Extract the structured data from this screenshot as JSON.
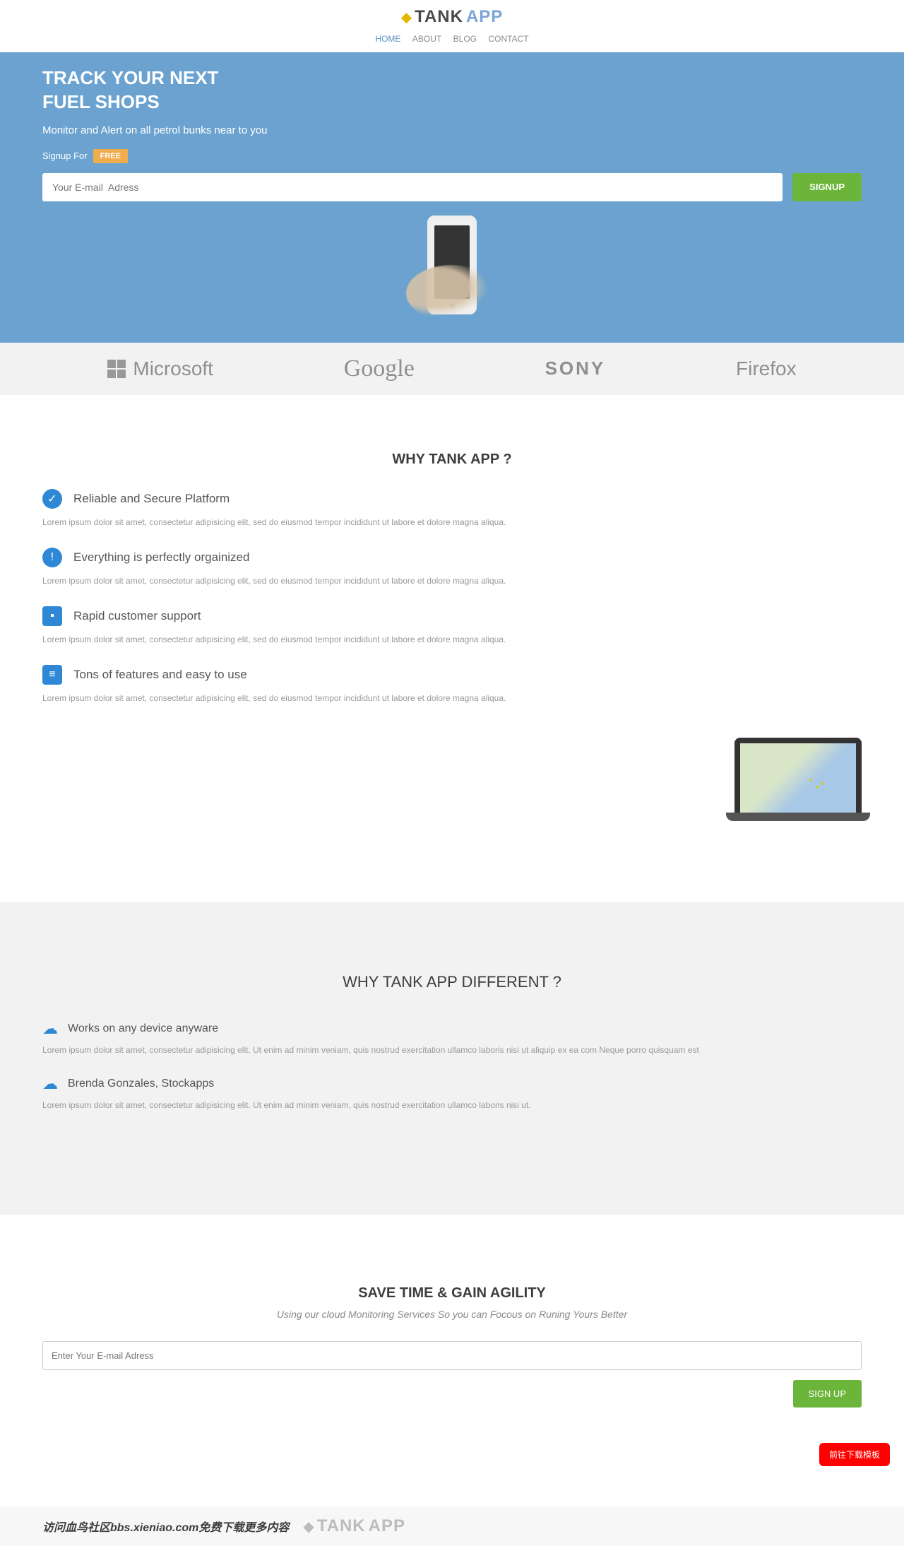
{
  "brand": {
    "part1": "TANK",
    "part2": "APP"
  },
  "nav": {
    "home": "HOME",
    "about": "ABOUT",
    "blog": "BLOG",
    "contact": "CONTACT"
  },
  "hero": {
    "title_line1": "TRACK YOUR NEXT",
    "title_line2": "FUEL SHOPS",
    "subtitle": "Monitor and Alert on all petrol bunks near to you",
    "signup_for": "Signup For",
    "free_label": "FREE",
    "email_placeholder": "Your E-mail  Adress",
    "signup_btn": "SIGNUP"
  },
  "brands": {
    "microsoft": "Microsoft",
    "google": "Google",
    "sony": "SONY",
    "firefox": "Firefox"
  },
  "why": {
    "heading": "WHY TANK APP ?",
    "items": [
      {
        "title": "Reliable and Secure Platform",
        "desc": "Lorem ipsum dolor sit amet, consectetur adipisicing elit, sed do eiusmod tempor incididunt ut labore et dolore magna aliqua."
      },
      {
        "title": "Everything is perfectly orgainized",
        "desc": "Lorem ipsum dolor sit amet, consectetur adipisicing elit, sed do eiusmod tempor incididunt ut labore et dolore magna aliqua."
      },
      {
        "title": "Rapid customer support",
        "desc": "Lorem ipsum dolor sit amet, consectetur adipisicing elit, sed do eiusmod tempor incididunt ut labore et dolore magna aliqua."
      },
      {
        "title": "Tons of features and easy to use",
        "desc": "Lorem ipsum dolor sit amet, consectetur adipisicing elit, sed do eiusmod tempor incididunt ut labore et dolore magna aliqua."
      }
    ]
  },
  "different": {
    "heading": "WHY TANK APP DIFFERENT ?",
    "items": [
      {
        "title": "Works on any device anyware",
        "desc": "Lorem ipsum dolor sit amet, consectetur adipisicing elit. Ut enim ad minim veniam, quis nostrud exercitation ullamco laboris nisi ut aliquip ex ea com Neque porro quisquam est"
      },
      {
        "title": "Brenda Gonzales, Stockapps",
        "desc": "Lorem ipsum dolor sit amet, consectetur adipisicing elit. Ut enim ad minim veniam, quis nostrud exercitation ullamco laboris nisi ut."
      }
    ]
  },
  "save": {
    "heading": "SAVE TIME & GAIN AGILITY",
    "tagline": "Using our cloud Monitoring Services So you can Focous on Runing Yours Better",
    "email_placeholder": "Enter Your E-mail Adress",
    "signup_btn": "SIGN UP"
  },
  "footer": {
    "chinese": "访问血鸟社区bbs.xieniao.com免费下载更多内容"
  },
  "float_btn": "前往下载模板"
}
